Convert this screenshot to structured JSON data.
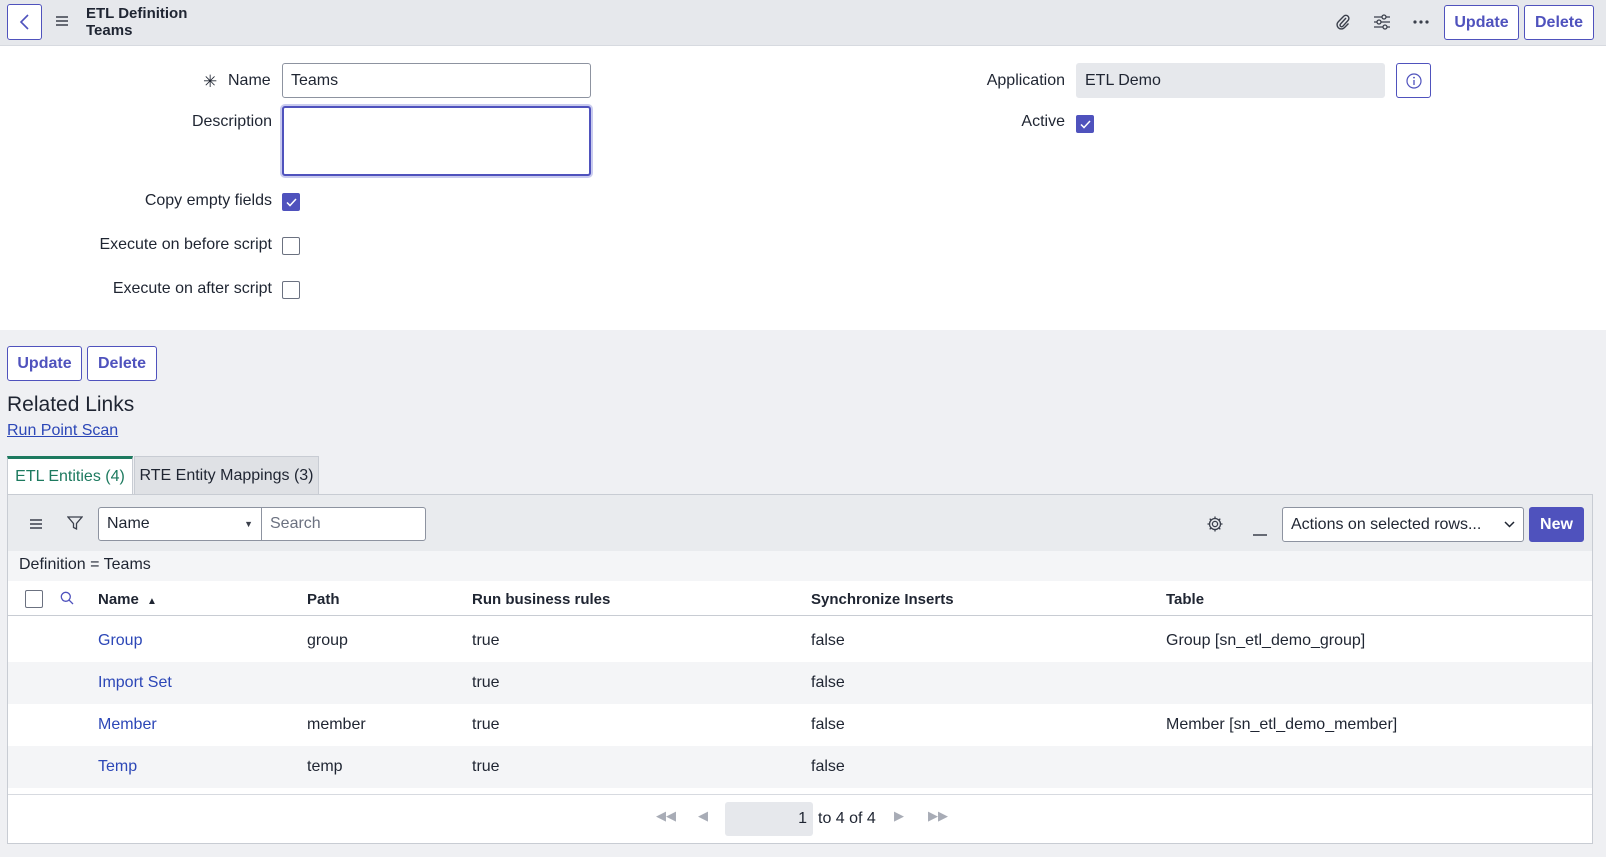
{
  "header": {
    "title_line1": "ETL Definition",
    "title_line2": "Teams",
    "update_label": "Update",
    "delete_label": "Delete"
  },
  "form": {
    "name_label": "Name",
    "name_required_mark": "✳",
    "name_value": "Teams",
    "description_label": "Description",
    "description_value": "",
    "copy_empty_label": "Copy empty fields",
    "copy_empty_checked": true,
    "exec_before_label": "Execute on before script",
    "exec_before_checked": false,
    "exec_after_label": "Execute on after script",
    "exec_after_checked": false,
    "application_label": "Application",
    "application_value": "ETL Demo",
    "active_label": "Active",
    "active_checked": true
  },
  "bottom_buttons": {
    "update_label": "Update",
    "delete_label": "Delete"
  },
  "related": {
    "heading": "Related Links",
    "link": "Run Point Scan"
  },
  "tabs": [
    {
      "label": "ETL Entities (4)",
      "active": true
    },
    {
      "label": "RTE Entity Mappings (3)",
      "active": false
    }
  ],
  "list": {
    "search_field": "Name",
    "search_placeholder": "Search",
    "actions_select": "Actions on selected rows...",
    "new_label": "New",
    "breadcrumb": "Definition = Teams",
    "columns": [
      "Name",
      "Path",
      "Run business rules",
      "Synchronize Inserts",
      "Table"
    ],
    "sort_indicator": "▲",
    "rows": [
      {
        "name": "Group",
        "path": "group",
        "run_br": "true",
        "sync": "false",
        "table": "Group [sn_etl_demo_group]"
      },
      {
        "name": "Import Set",
        "path": "",
        "run_br": "true",
        "sync": "false",
        "table": ""
      },
      {
        "name": "Member",
        "path": "member",
        "run_br": "true",
        "sync": "false",
        "table": "Member [sn_etl_demo_member]"
      },
      {
        "name": "Temp",
        "path": "temp",
        "run_br": "true",
        "sync": "false",
        "table": ""
      }
    ],
    "pager_page": "1",
    "pager_text": "to 4 of 4"
  },
  "colors": {
    "accent": "#4f52bd",
    "link": "#2c47b7",
    "active_tab": "#1d7a5f"
  }
}
